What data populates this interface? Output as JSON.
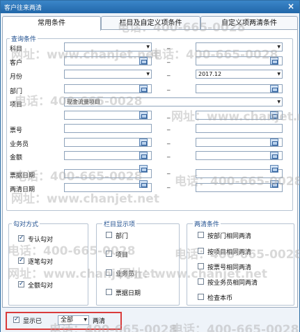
{
  "window": {
    "title": "客户往来两清",
    "close_label": "×"
  },
  "tabs": [
    {
      "label": "常用条件",
      "active": true
    },
    {
      "label": "栏目及自定义项条件",
      "active": false
    },
    {
      "label": "自定义项两清条件",
      "active": false
    }
  ],
  "query": {
    "group_title": "查询条件",
    "range_sep": "_",
    "labels": {
      "subject": "科目",
      "customer": "客户",
      "month": "月份",
      "department": "部门",
      "item": "项目",
      "voucher_no": "票号",
      "salesperson": "业务员",
      "amount": "金额",
      "voucher_date": "票据日期",
      "clear_date": "两清日期"
    },
    "values": {
      "month_to": "2017.12",
      "item_class": "现金流量项目"
    }
  },
  "match_mode": {
    "title": "勾对方式",
    "options": [
      {
        "label": "专认勾对",
        "checked": true
      },
      {
        "label": "逐笔勾对",
        "checked": true
      },
      {
        "label": "全额勾对",
        "checked": true
      }
    ]
  },
  "columns": {
    "title": "栏目显示项",
    "options": [
      {
        "label": "部门",
        "checked": false
      },
      {
        "label": "项目",
        "checked": false
      },
      {
        "label": "业务员",
        "checked": false
      },
      {
        "label": "票据日期",
        "checked": false
      }
    ]
  },
  "clear_conditions": {
    "title": "两清条件",
    "options": [
      {
        "label": "按部门相同两清",
        "checked": false
      },
      {
        "label": "按项目相同两清",
        "checked": false
      },
      {
        "label": "按票号相同两清",
        "checked": false
      },
      {
        "label": "按业务员相同两清",
        "checked": false
      },
      {
        "label": "检查本币",
        "checked": false
      }
    ]
  },
  "footer": {
    "show_label": "显示已",
    "show_checked": true,
    "scope_value": "全部",
    "suffix": "两清"
  },
  "watermark": {
    "phone": "电话：400-665-0028",
    "site": "网址：www.chanjet.net"
  },
  "colors": {
    "title_bar": "#2a73b8",
    "highlight": "#d93b3b"
  }
}
